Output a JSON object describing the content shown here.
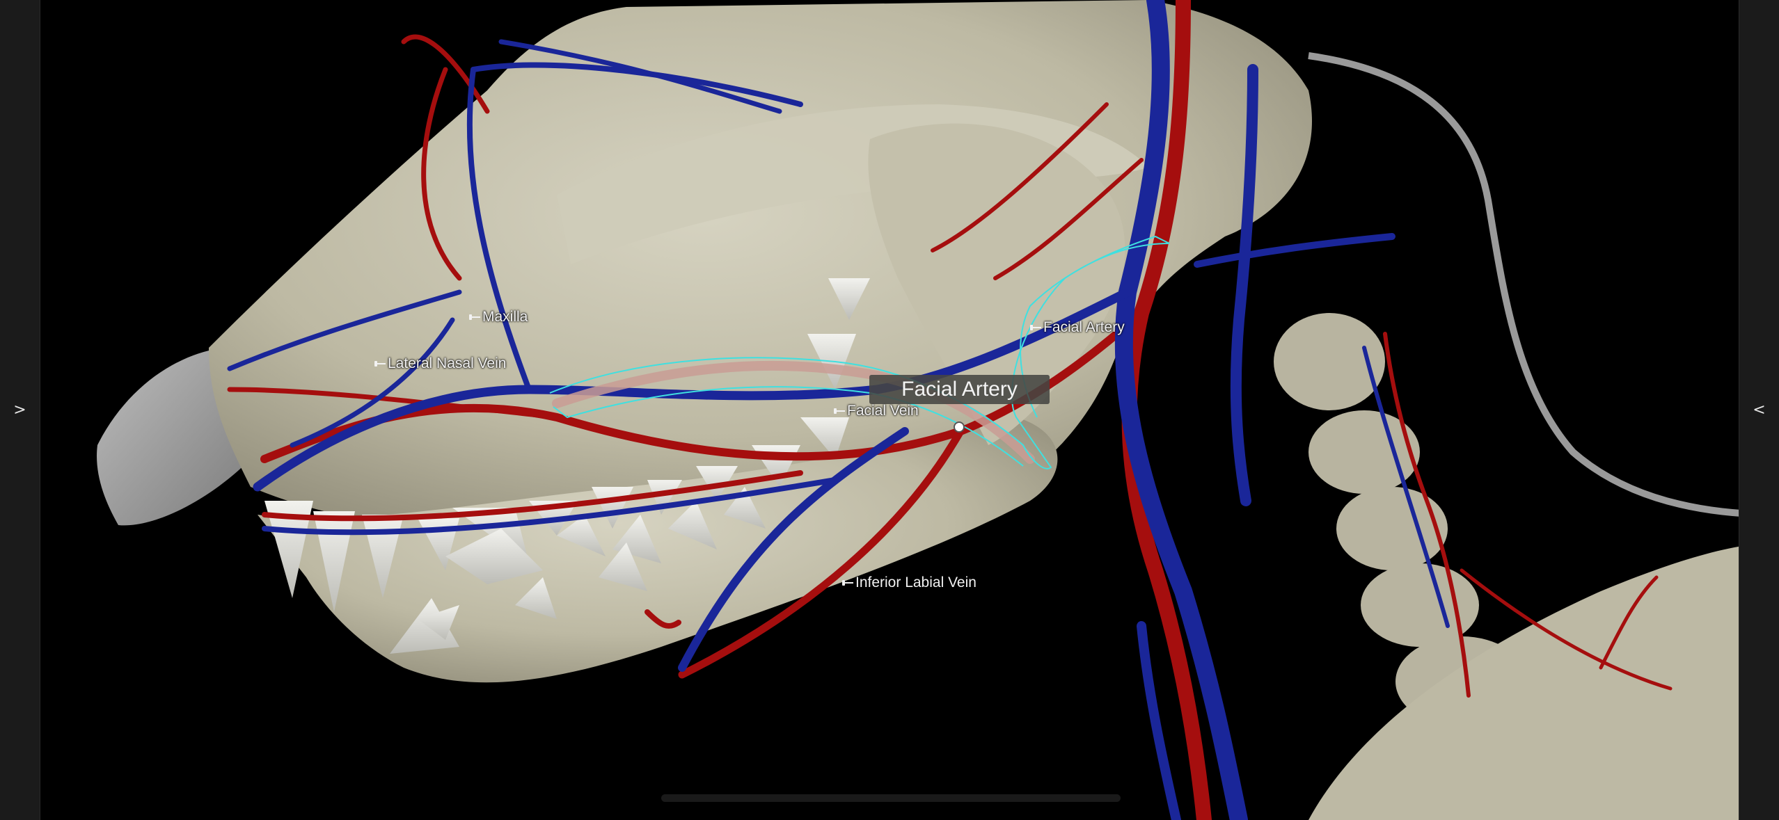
{
  "app": {
    "left_panel_toggle": ">",
    "right_panel_toggle": "<"
  },
  "selection": {
    "tooltip_title": "Facial Artery"
  },
  "labels": {
    "maxilla": "Maxilla",
    "lateral_nasal_vein": "Lateral Nasal Vein",
    "facial_vein": "Facial Vein",
    "facial_artery": "Facial Artery",
    "inferior_labial_vein": "Inferior Labial Vein"
  },
  "colors": {
    "background": "#000000",
    "bone": "#c9c5b1",
    "artery": "#b01010",
    "vein": "#1a2a9a",
    "highlight_outline": "#3fe0e0",
    "tooltip_bg": "#46463f"
  }
}
